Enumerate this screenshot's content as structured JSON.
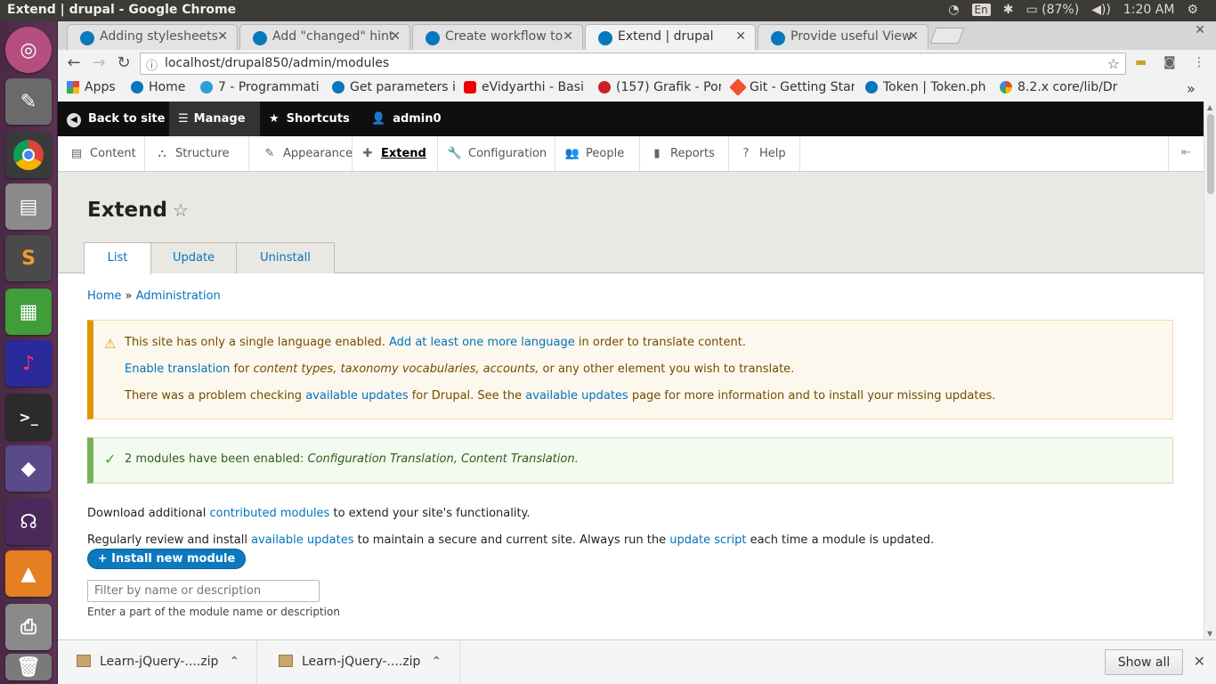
{
  "os": {
    "window_title": "Extend | drupal - Google Chrome",
    "input_lang": "En",
    "battery": "(87%)",
    "clock": "1:20 AM"
  },
  "launcher": {
    "items": [
      "ubuntu-dash",
      "system-settings",
      "chrome",
      "files",
      "sublime-text",
      "libreoffice-calc",
      "audacity",
      "terminal",
      "unknown-app",
      "headphones-app",
      "vlc",
      "printer-app",
      "trash"
    ]
  },
  "browser": {
    "tabs": [
      {
        "label": "Adding stylesheets"
      },
      {
        "label": "Add \"changed\" hint"
      },
      {
        "label": "Create workflow to"
      },
      {
        "label": "Extend | drupal"
      },
      {
        "label": "Provide useful View"
      }
    ],
    "url": "localhost/drupal850/admin/modules",
    "bookmarks": [
      {
        "label": "Apps"
      },
      {
        "label": "Home"
      },
      {
        "label": "7 - Programmati"
      },
      {
        "label": "Get parameters i"
      },
      {
        "label": "eVidyarthi - Basi"
      },
      {
        "label": "(157) Grafik - Por"
      },
      {
        "label": "Git - Getting Star"
      },
      {
        "label": "Token | Token.ph"
      },
      {
        "label": "8.2.x core/lib/Dr"
      }
    ],
    "more": "»"
  },
  "admin_bar": {
    "back": "Back to site",
    "manage": "Manage",
    "shortcuts": "Shortcuts",
    "user": "admin0"
  },
  "admin_tray": {
    "items": [
      {
        "label": "Content"
      },
      {
        "label": "Structure"
      },
      {
        "label": "Appearance"
      },
      {
        "label": "Extend"
      },
      {
        "label": "Configuration"
      },
      {
        "label": "People"
      },
      {
        "label": "Reports"
      },
      {
        "label": "Help"
      }
    ]
  },
  "page": {
    "title": "Extend",
    "tabs": [
      "List",
      "Update",
      "Uninstall"
    ],
    "breadcrumb": {
      "home": "Home",
      "sep": "»",
      "admin": "Administration"
    },
    "warning": {
      "l1_a": "This site has only a single language enabled.",
      "l1_link": "Add at least one more language",
      "l1_b": "in order to translate content.",
      "l2_link": "Enable translation",
      "l2_a": "for",
      "l2_em": "content types, taxonomy vocabularies, accounts,",
      "l2_b": "or any other element you wish to translate.",
      "l3_a": "There was a problem checking",
      "l3_link1": "available updates",
      "l3_b": "for Drupal. See the",
      "l3_link2": "available updates",
      "l3_c": "page for more information and to install your missing updates."
    },
    "status": {
      "text": "2 modules have been enabled:",
      "em": "Configuration Translation, Content Translation."
    },
    "p1": {
      "a": "Download additional",
      "link": "contributed modules",
      "b": "to extend your site's functionality."
    },
    "p2": {
      "a": "Regularly review and install",
      "link1": "available updates",
      "b": "to maintain a secure and current site. Always run the",
      "link2": "update script",
      "c": "each time a module is updated."
    },
    "install_button": "+ Install new module",
    "filter_placeholder": "Filter by name or description",
    "filter_description": "Enter a part of the module name or description"
  },
  "downloads": {
    "items": [
      {
        "name": "Learn-jQuery-....zip"
      },
      {
        "name": "Learn-jQuery-....zip"
      }
    ],
    "show_all": "Show all"
  }
}
